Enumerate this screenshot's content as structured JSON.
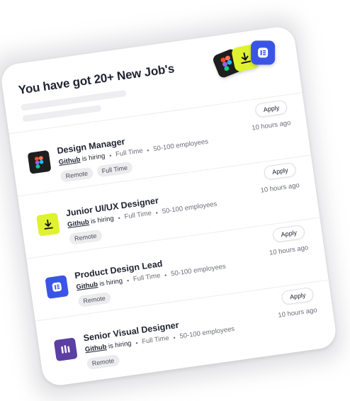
{
  "header": {
    "title": "You have got 20+ New Job's"
  },
  "colors": {
    "figma_bg": "#1e1e1e",
    "download_bg": "#dff230",
    "elementor_bg": "#3a55e6",
    "visual_bg": "#5b3fa3"
  },
  "header_icons": [
    "figma-icon",
    "download-icon",
    "elementor-icon"
  ],
  "jobs": [
    {
      "title": "Design Manager",
      "company": "Github",
      "hiring": "is hiring",
      "type": "Full Time",
      "size": "50-100 employees",
      "time": "10 hours ago",
      "apply": "Apply",
      "tags": [
        "Remote",
        "Full Time"
      ],
      "icon": "figma-icon"
    },
    {
      "title": "Junior UI/UX Designer",
      "company": "Github",
      "hiring": "is hiring",
      "type": "Full Time",
      "size": "50-100 employees",
      "time": "10 hours ago",
      "apply": "Apply",
      "tags": [
        "Remote"
      ],
      "icon": "download-icon"
    },
    {
      "title": "Product Design Lead",
      "company": "Github",
      "hiring": "is hiring",
      "type": "Full Time",
      "size": "50-100 employees",
      "time": "10 hours ago",
      "apply": "Apply",
      "tags": [
        "Remote"
      ],
      "icon": "elementor-icon"
    },
    {
      "title": "Senior Visual Designer",
      "company": "Github",
      "hiring": "is hiring",
      "type": "Full Time",
      "size": "50-100 employees",
      "time": "10 hours ago",
      "apply": "Apply",
      "tags": [
        "Remote"
      ],
      "icon": "visual-icon"
    }
  ]
}
